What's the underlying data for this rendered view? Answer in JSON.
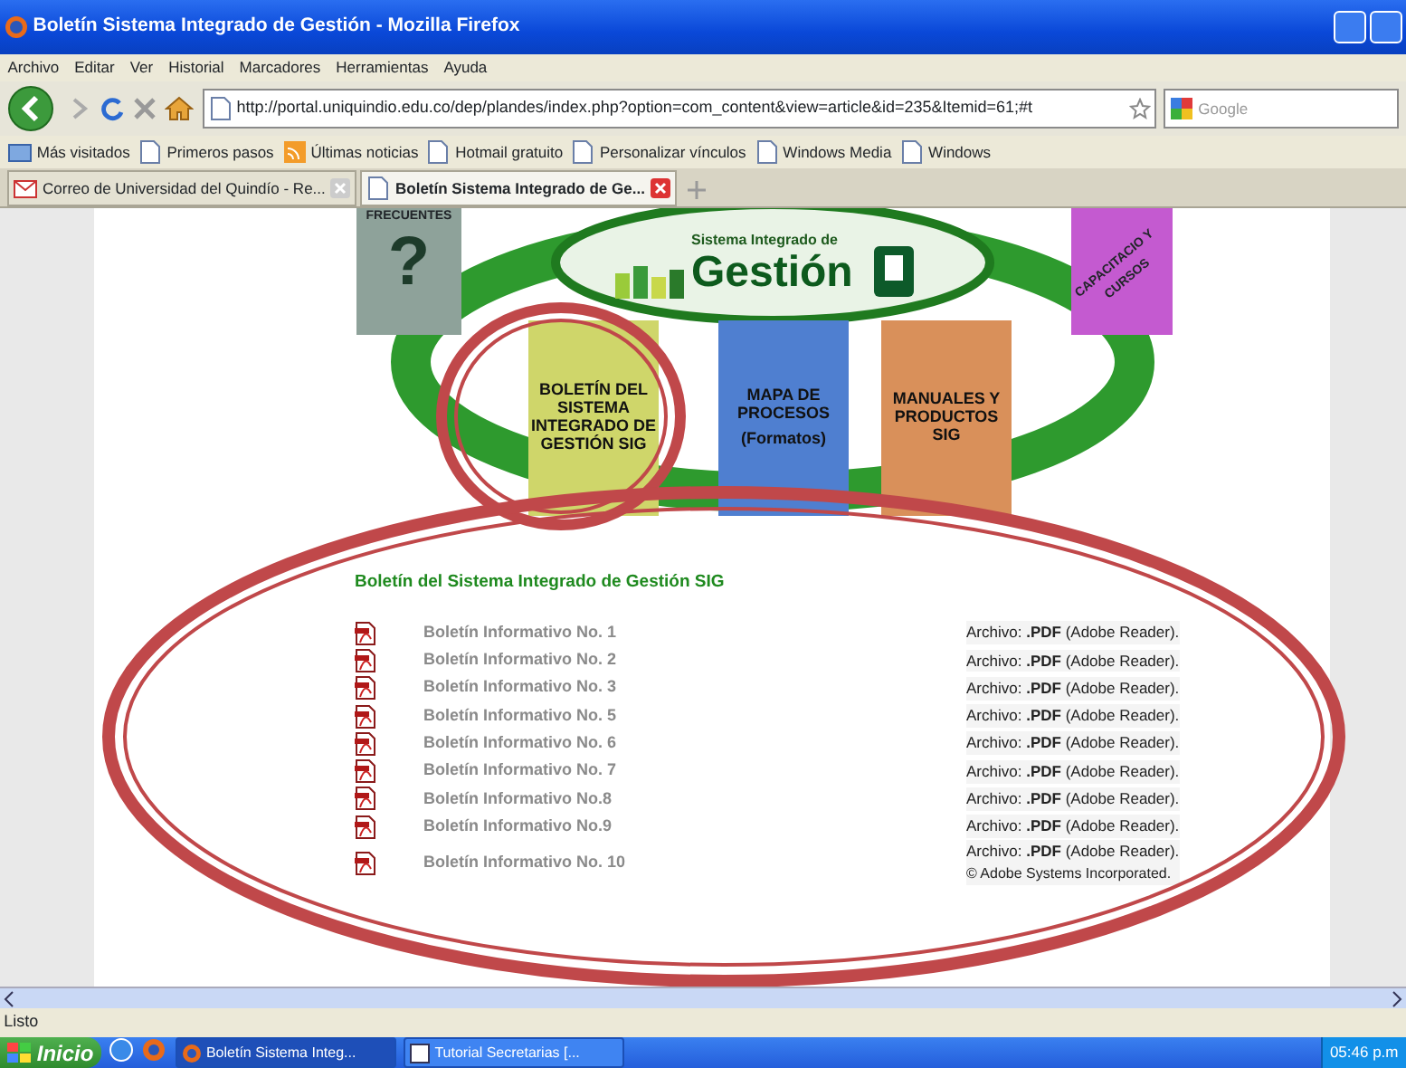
{
  "window": {
    "title": "Boletín Sistema Integrado de Gestión - Mozilla Firefox"
  },
  "menu": [
    "Archivo",
    "Editar",
    "Ver",
    "Historial",
    "Marcadores",
    "Herramientas",
    "Ayuda"
  ],
  "toolbar": {
    "url": "http://portal.uniquindio.edu.co/dep/plandes/index.php?option=com_content&view=article&id=235&Itemid=61;#t",
    "search_placeholder": "Google"
  },
  "bookmarks": [
    {
      "label": "Más visitados",
      "kind": "folder"
    },
    {
      "label": "Primeros pasos",
      "kind": "page"
    },
    {
      "label": "Últimas noticias",
      "kind": "feed"
    },
    {
      "label": "Hotmail gratuito",
      "kind": "page"
    },
    {
      "label": "Personalizar vínculos",
      "kind": "page"
    },
    {
      "label": "Windows Media",
      "kind": "page"
    },
    {
      "label": "Windows",
      "kind": "page"
    }
  ],
  "tabs": [
    {
      "label": "Correo de Universidad del Quindío - Re...",
      "kind": "mail",
      "selected": false
    },
    {
      "label": "Boletín Sistema Integrado de Ge...",
      "kind": "page",
      "selected": true
    }
  ],
  "banner": {
    "faq_label": "FRECUENTES",
    "faq_mark": "?",
    "logo_small": "Sistema Integrado de",
    "logo_big": "Gestión",
    "cards": [
      {
        "label": "BOLETÍN DEL SISTEMA INTEGRADO DE GESTIÓN SIG",
        "color": "#cfd66a"
      },
      {
        "label": "MAPA DE PROCESOS",
        "sub": "(Formatos)",
        "color": "#4f7fd0"
      },
      {
        "label": "MANUALES Y PRODUCTOS SIG",
        "color": "#d9905a"
      }
    ],
    "training_label": "CAPACITACIO Y CURSOS"
  },
  "section": {
    "heading": "Boletín del Sistema Integrado de Gestión SIG",
    "documents": [
      {
        "title": "Boletín Informativo No. 1",
        "file": "Archivo: **.PDF** (Adobe Reader)."
      },
      {
        "title": "Boletín Informativo No. 2",
        "file": "Archivo: **.PDF** (Adobe Reader)."
      },
      {
        "title": "Boletín Informativo No. 3",
        "file": "Archivo: **.PDF** (Adobe Reader)."
      },
      {
        "title": "Boletín Informativo No. 5",
        "file": "Archivo: **.PDF** (Adobe Reader)."
      },
      {
        "title": "Boletín Informativo No. 6",
        "file": "Archivo: **.PDF** (Adobe Reader)."
      },
      {
        "title": "Boletín Informativo No. 7",
        "file": "Archivo: **.PDF** (Adobe Reader)."
      },
      {
        "title": "Boletín Informativo No.8",
        "file": "Archivo: **.PDF** (Adobe Reader)."
      },
      {
        "title": "Boletín Informativo No.9",
        "file": "Archivo: **.PDF** (Adobe Reader)."
      },
      {
        "title": "Boletín Informativo No. 10",
        "file": "Archivo: **.PDF** (Adobe Reader).",
        "note": "© Adobe Systems Incorporated."
      }
    ]
  },
  "status_bar": "Listo",
  "taskbar": {
    "start": "Inicio",
    "tasks": [
      {
        "label": "Boletín Sistema Integ...",
        "kind": "firefox",
        "selected": true
      },
      {
        "label": "Tutorial Secretarias [...",
        "kind": "doc",
        "selected": false
      }
    ],
    "clock": "05:46 p.m"
  }
}
